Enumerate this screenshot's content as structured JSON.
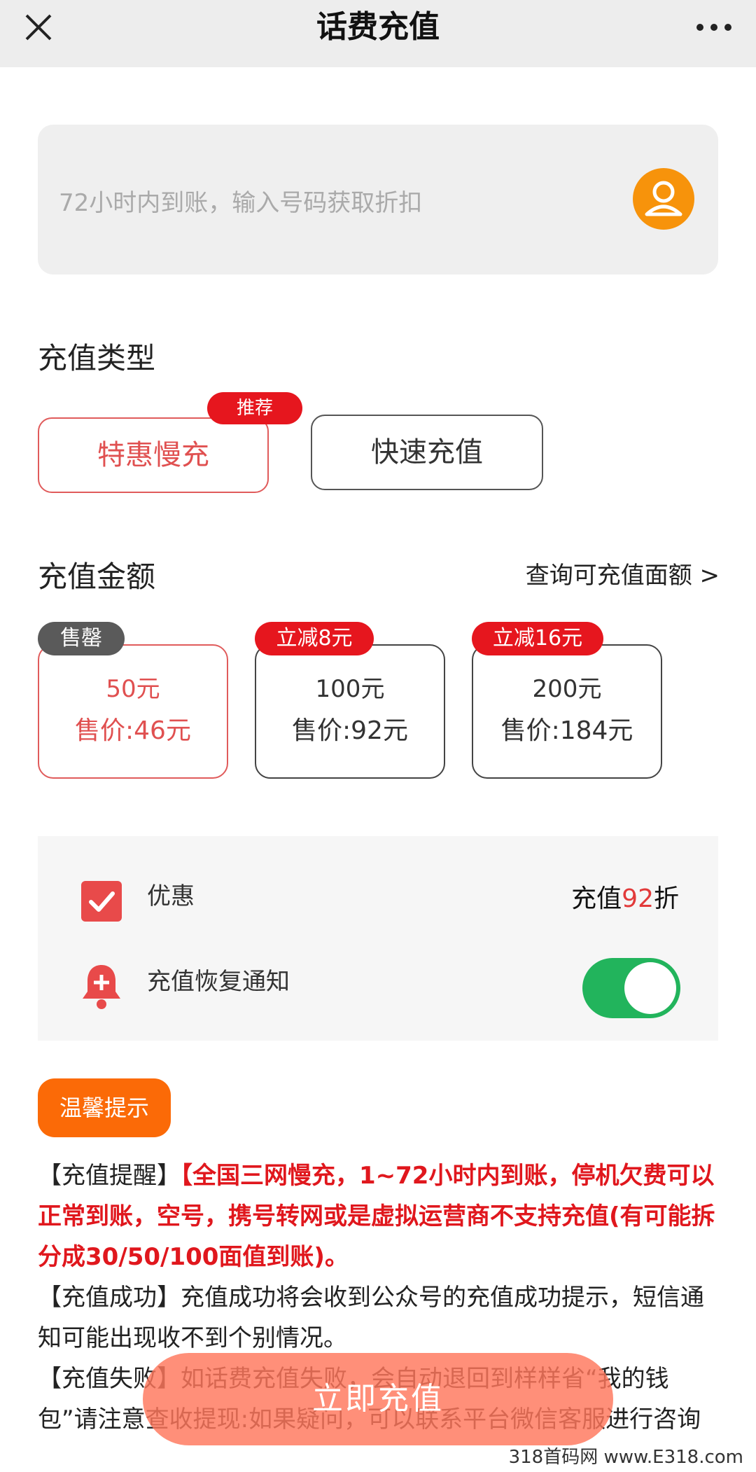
{
  "header": {
    "title": "话费充值"
  },
  "phone_input": {
    "placeholder": "72小时内到账，输入号码获取折扣"
  },
  "recharge_type": {
    "title": "充值类型",
    "options": [
      {
        "label": "特惠慢充",
        "badge": "推荐",
        "selected": true
      },
      {
        "label": "快速充值",
        "badge": "",
        "selected": false
      }
    ]
  },
  "recharge_amount": {
    "title": "充值金额",
    "query_link": "查询可充值面额 >",
    "items": [
      {
        "badge": "售罄",
        "face": "50元",
        "price": "售价:46元",
        "selected": true
      },
      {
        "badge": "立减8元",
        "face": "100元",
        "price": "售价:92元",
        "selected": false
      },
      {
        "badge": "立减16元",
        "face": "200元",
        "price": "售价:184元",
        "selected": false
      }
    ]
  },
  "options_panel": {
    "discount_label": "优惠",
    "discount_prefix": "充值",
    "discount_value": "92",
    "discount_suffix": "折",
    "notify_label": "充值恢复通知",
    "notify_enabled": true
  },
  "tips": {
    "badge": "温馨提示",
    "reminder_tag": "【充值提醒】",
    "reminder_text": "【全国三网慢充，1~72小时内到账，停机欠费可以正常到账，空号，携号转网或是虚拟运营商不支持充值(有可能拆分成30/50/100面值到账)。",
    "success_tag": "【充值成功】",
    "success_text": "充值成功将会收到公众号的充值成功提示，短信通知可能出现收不到个别情况。",
    "fail_tag": "【充值失败】",
    "fail_text": "如话费充值失败，会自动退回到样样省“我的钱包”请注意查收提现:如果疑问，可以联系平台微信客服进行咨询"
  },
  "cta": {
    "label": "立即充值"
  },
  "watermark": "318首码网 www.E318.com",
  "colors": {
    "accent_red": "#e6161e",
    "orange": "#fb6a07",
    "toggle_green": "#22b45c",
    "avatar_orange": "#f7930b"
  }
}
